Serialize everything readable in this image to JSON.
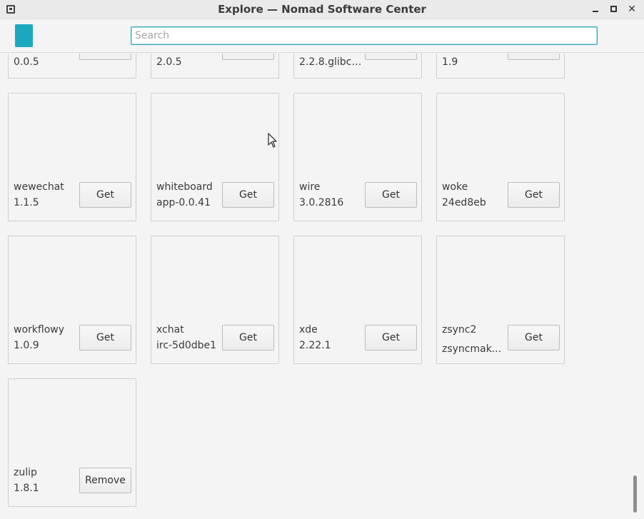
{
  "window": {
    "title": "Explore — Nomad Software Center"
  },
  "search": {
    "placeholder": "Search",
    "value": ""
  },
  "top_row": [
    {
      "version": "0.0.5"
    },
    {
      "version": "2.0.5"
    },
    {
      "version": "2.2.8.glibc2…"
    },
    {
      "version": "1.9"
    }
  ],
  "apps": [
    {
      "name": "wewechat",
      "version": "1.1.5",
      "action": "Get"
    },
    {
      "name": "whiteboard",
      "version": "app-0.0.41",
      "action": "Get"
    },
    {
      "name": "wire",
      "version": "3.0.2816",
      "action": "Get"
    },
    {
      "name": "woke",
      "version": "24ed8eb",
      "action": "Get"
    },
    {
      "name": "workflowy",
      "version": "1.0.9",
      "action": "Get"
    },
    {
      "name": "xchat",
      "version": "irc-5d0dbe1",
      "action": "Get"
    },
    {
      "name": "xde",
      "version": "2.22.1",
      "action": "Get"
    },
    {
      "name": "zsync2",
      "version": "zsyncmake…",
      "action": "Get"
    },
    {
      "name": "zulip",
      "version": "1.8.1",
      "action": "Remove"
    }
  ],
  "colors": {
    "accent": "#1ba8bf",
    "background": "#f4f4f4",
    "card_border": "#cfcfcf"
  },
  "icons": [
    "window-menu-icon",
    "minimize-icon",
    "maximize-icon",
    "close-icon",
    "app-tile-icon",
    "mouse-cursor-icon"
  ]
}
